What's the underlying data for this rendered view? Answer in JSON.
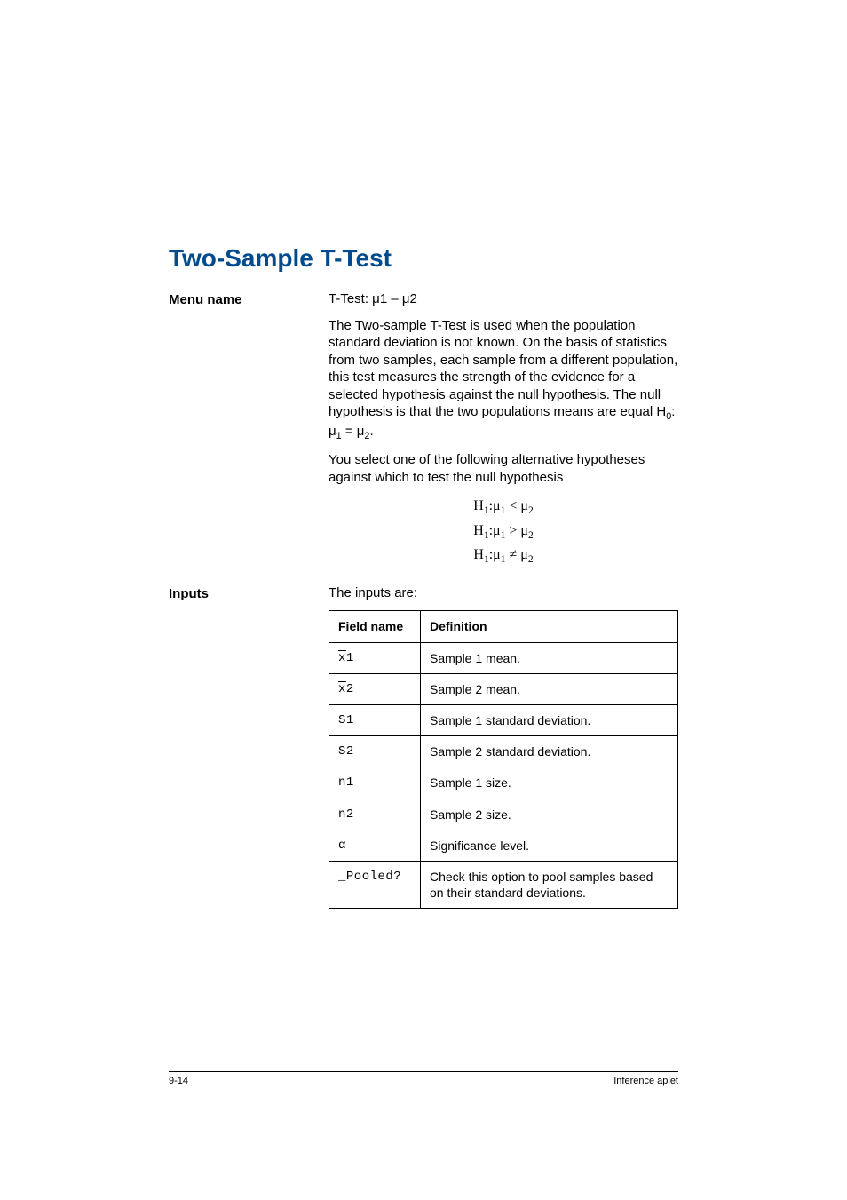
{
  "title": "Two-Sample T-Test",
  "menu_name": {
    "label": "Menu name",
    "value": "T-Test: μ1 – μ2"
  },
  "description": {
    "para1": "The Two-sample T-Test is used when the population standard deviation is not known. On the basis of statistics from two samples, each sample from a different population, this test measures the strength of the evidence for a selected hypothesis against the null hypothesis. The null hypothesis is that the two populations means are equal H0: μ1 = μ2.",
    "para2": "You select one of the following alternative hypotheses against which to test the null hypothesis"
  },
  "hypotheses": {
    "h1": "H1:μ1 < μ2",
    "h2": "H1:μ1 > μ2",
    "h3": "H1:μ1 ≠ μ2"
  },
  "inputs_section": {
    "label": "Inputs",
    "intro": "The inputs are:",
    "headers": {
      "field": "Field name",
      "definition": "Definition"
    },
    "rows": [
      {
        "field": "x̄1",
        "definition": "Sample 1 mean."
      },
      {
        "field": "x̄2",
        "definition": "Sample 2 mean."
      },
      {
        "field": "S1",
        "definition": "Sample 1 standard deviation."
      },
      {
        "field": "S2",
        "definition": "Sample 2 standard deviation."
      },
      {
        "field": "n1",
        "definition": "Sample 1 size."
      },
      {
        "field": "n2",
        "definition": "Sample 2 size."
      },
      {
        "field": "α",
        "definition": "Significance level."
      },
      {
        "field": "_Pooled?",
        "definition": "Check this option to pool samples based on their standard deviations."
      }
    ]
  },
  "footer": {
    "left": "9-14",
    "right": "Inference aplet"
  }
}
